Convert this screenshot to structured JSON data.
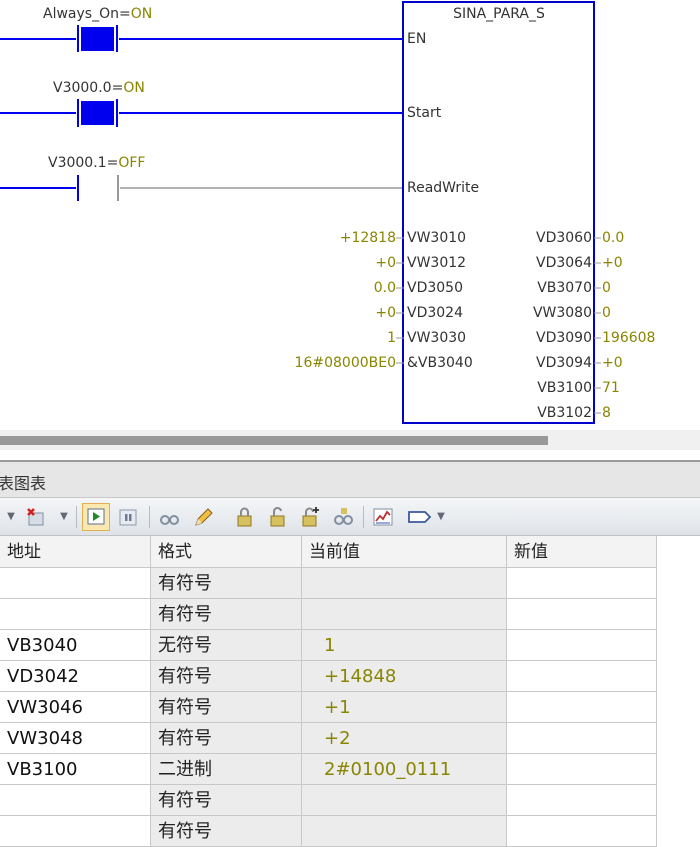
{
  "ladder": {
    "contacts": [
      {
        "address": "Always_On",
        "state": "ON"
      },
      {
        "address": "V3000.0",
        "state": "ON"
      },
      {
        "address": "V3000.1",
        "state": "OFF"
      }
    ],
    "block": {
      "title": "SINA_PARA_S",
      "control_pins": [
        "EN",
        "Start",
        "ReadWrite"
      ],
      "inputs": [
        {
          "pin": "VW3010",
          "value": "+12818"
        },
        {
          "pin": "VW3012",
          "value": "+0"
        },
        {
          "pin": "VD3050",
          "value": "0.0"
        },
        {
          "pin": "VD3024",
          "value": "+0"
        },
        {
          "pin": "VW3030",
          "value": "1"
        },
        {
          "pin": "&VB3040",
          "value": "16#08000BE0"
        }
      ],
      "outputs": [
        {
          "pin": "VD3060",
          "value": "0.0"
        },
        {
          "pin": "VD3064",
          "value": "+0"
        },
        {
          "pin": "VB3070",
          "value": "0"
        },
        {
          "pin": "VW3080",
          "value": "0"
        },
        {
          "pin": "VD3090",
          "value": "196608"
        },
        {
          "pin": "VD3094",
          "value": "+0"
        },
        {
          "pin": "VB3100",
          "value": "71"
        },
        {
          "pin": "VB3102",
          "value": "8"
        }
      ]
    },
    "colors": {
      "energized": "#0000ee",
      "inactive": "#999999",
      "value": "#8a8500"
    }
  },
  "panel": {
    "title": "表图表"
  },
  "toolbar": {
    "icons": [
      "dropdown-arrow-icon",
      "delete-row-icon",
      "dropdown-arrow-icon",
      "start-monitoring-icon",
      "pause-icon",
      "read-glasses-icon",
      "write-pencil-icon",
      "force-icon",
      "unforce-icon",
      "unforce-all-icon",
      "read-all-forced-icon",
      "trend-view-icon",
      "tag-icon",
      "dropdown-arrow-icon"
    ]
  },
  "table": {
    "headers": {
      "address": "地址",
      "format": "格式",
      "current": "当前值",
      "new": "新值"
    },
    "rows": [
      {
        "address": "",
        "format": "有符号",
        "current": ""
      },
      {
        "address": "",
        "format": "有符号",
        "current": ""
      },
      {
        "address": "VB3040",
        "format": "无符号",
        "current": "1"
      },
      {
        "address": "VD3042",
        "format": "有符号",
        "current": "+14848"
      },
      {
        "address": "VW3046",
        "format": "有符号",
        "current": "+1"
      },
      {
        "address": "VW3048",
        "format": "有符号",
        "current": "+2"
      },
      {
        "address": "VB3100",
        "format": "二进制",
        "current": "2#0100_0111"
      },
      {
        "address": "",
        "format": "有符号",
        "current": ""
      },
      {
        "address": "",
        "format": "有符号",
        "current": ""
      }
    ]
  }
}
